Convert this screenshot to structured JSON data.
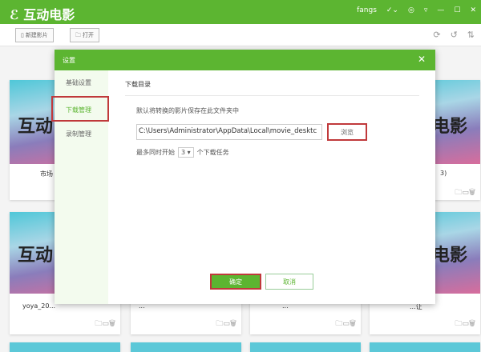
{
  "app": {
    "title": "互动电影",
    "user": "fangs"
  },
  "toolbar": {
    "new_movie": "新建影片",
    "open": "打开"
  },
  "cards": [
    {
      "caption": "市场"
    },
    {
      "caption": ""
    },
    {
      "caption": ""
    },
    {
      "caption": "3)"
    },
    {
      "caption": "yoya_20..."
    },
    {
      "caption": "..."
    },
    {
      "caption": "..."
    },
    {
      "caption": "...让"
    }
  ],
  "thumb": {
    "left_text": "互动",
    "right_text": "电影"
  },
  "dialog": {
    "title": "设置",
    "nav": [
      "基础设置",
      "下载管理",
      "录制管理"
    ],
    "section": "下载目录",
    "desc": "默认将转换的影片保存在此文件夹中",
    "path": "C:\\Users\\Administrator\\AppData\\Local\\movie_desktc",
    "browse": "浏览",
    "limit_prefix": "最多同时开始",
    "limit_value": "3",
    "limit_suffix": "个下载任务",
    "ok": "确定",
    "cancel": "取消"
  }
}
